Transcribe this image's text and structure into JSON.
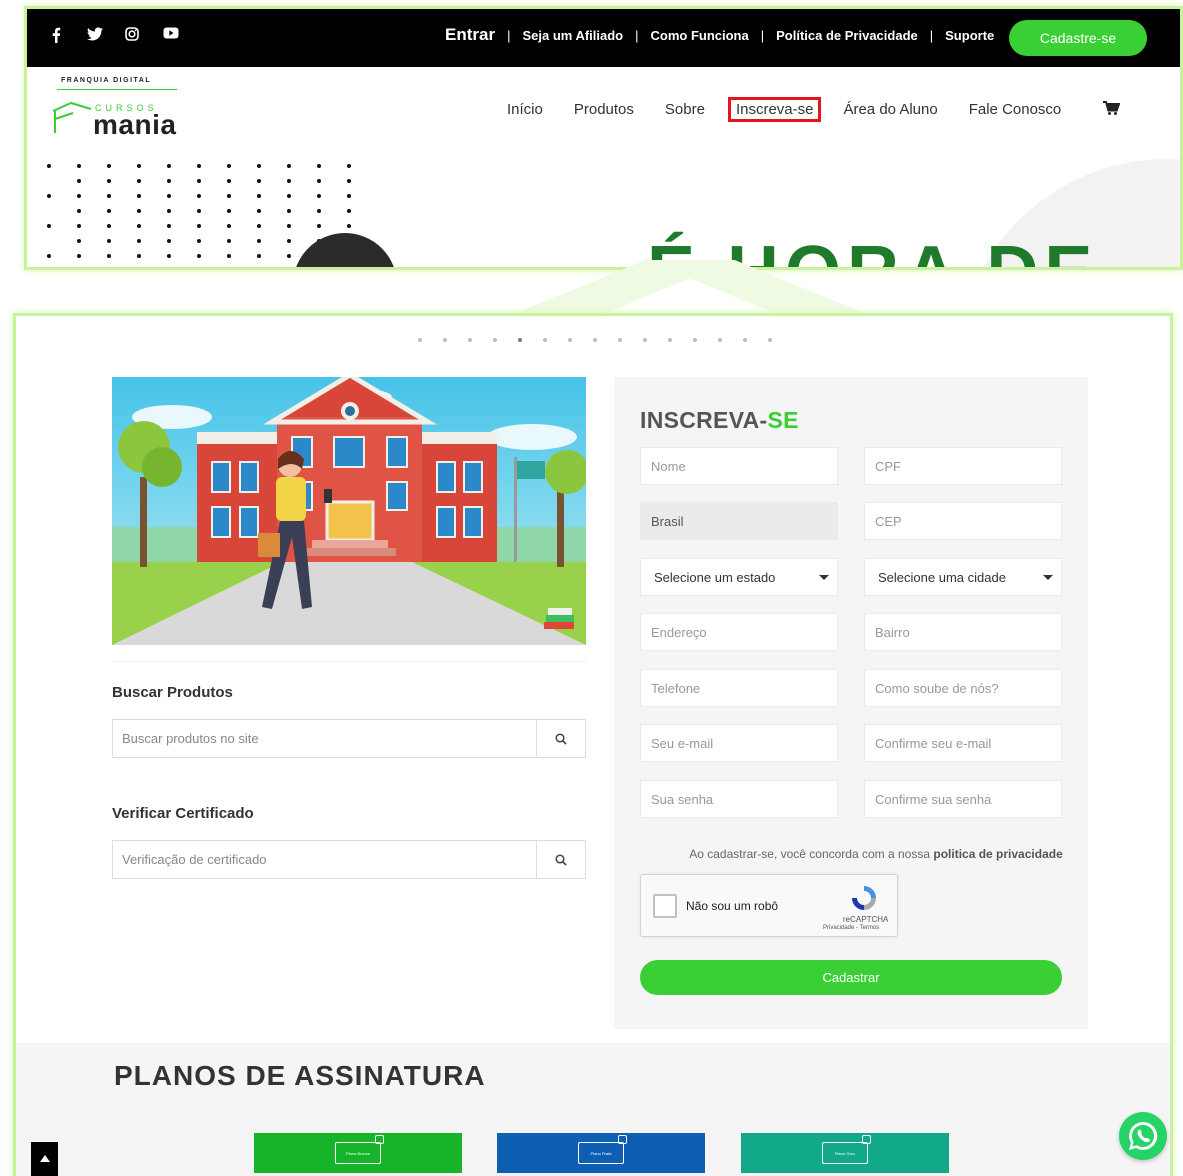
{
  "header": {
    "social_icons": [
      "facebook-icon",
      "twitter-icon",
      "instagram-icon",
      "youtube-icon"
    ],
    "entrar": "Entrar",
    "separator": "|",
    "links": [
      "Seja um Afiliado",
      "Como Funciona",
      "Política de Privacidade",
      "Suporte"
    ],
    "signup_button": "Cadastre-se"
  },
  "logo": {
    "franquia": "FRANQUIA DIGITAL",
    "cursos": "CURSOS",
    "mania": "mania"
  },
  "nav": {
    "items": [
      "Início",
      "Produtos",
      "Sobre",
      "Inscreva-se",
      "Área do Aluno",
      "Fale Conosco"
    ],
    "active_index": 3,
    "cart_icon": "cart-icon"
  },
  "hero": {
    "title_fragment": "É HORA DE"
  },
  "slider": {
    "dot_count": 15,
    "active_dot": 4
  },
  "sidebar": {
    "search_products": {
      "heading": "Buscar Produtos",
      "placeholder": "Buscar produtos no site"
    },
    "verify_certificate": {
      "heading": "Verificar Certificado",
      "placeholder": "Verificação de certificado"
    }
  },
  "form": {
    "title_main": "INSCREVA-",
    "title_highlight": "SE",
    "fields": {
      "nome": "Nome",
      "cpf": "CPF",
      "pais": "Brasil",
      "cep": "CEP",
      "estado": "Selecione um estado",
      "cidade": "Selecione uma cidade",
      "endereco": "Endereço",
      "bairro": "Bairro",
      "telefone": "Telefone",
      "como_soube": "Como soube de nós?",
      "email": "Seu e-mail",
      "confirm_email": "Confirme seu e-mail",
      "senha": "Sua senha",
      "confirm_senha": "Confirme sua senha"
    },
    "terms_text": "Ao cadastrar-se, você concorda com a nossa",
    "terms_link": "politica de privacidade",
    "captcha": {
      "label": "Não sou um robô",
      "brand": "reCAPTCHA",
      "links": "Privacidade - Termos"
    },
    "submit": "Cadastrar"
  },
  "plans": {
    "heading": "PLANOS DE ASSINATURA",
    "items": [
      "Plano Bronze",
      "Plano Prata",
      "Plano Ouro"
    ]
  },
  "colors": {
    "accent": "#3bcf36",
    "nav_active_border": "#e3161f",
    "plan_bronze": "#16b429",
    "plan_prata": "#0e5fb3",
    "plan_ouro": "#12a98a",
    "whatsapp": "#25d366"
  }
}
